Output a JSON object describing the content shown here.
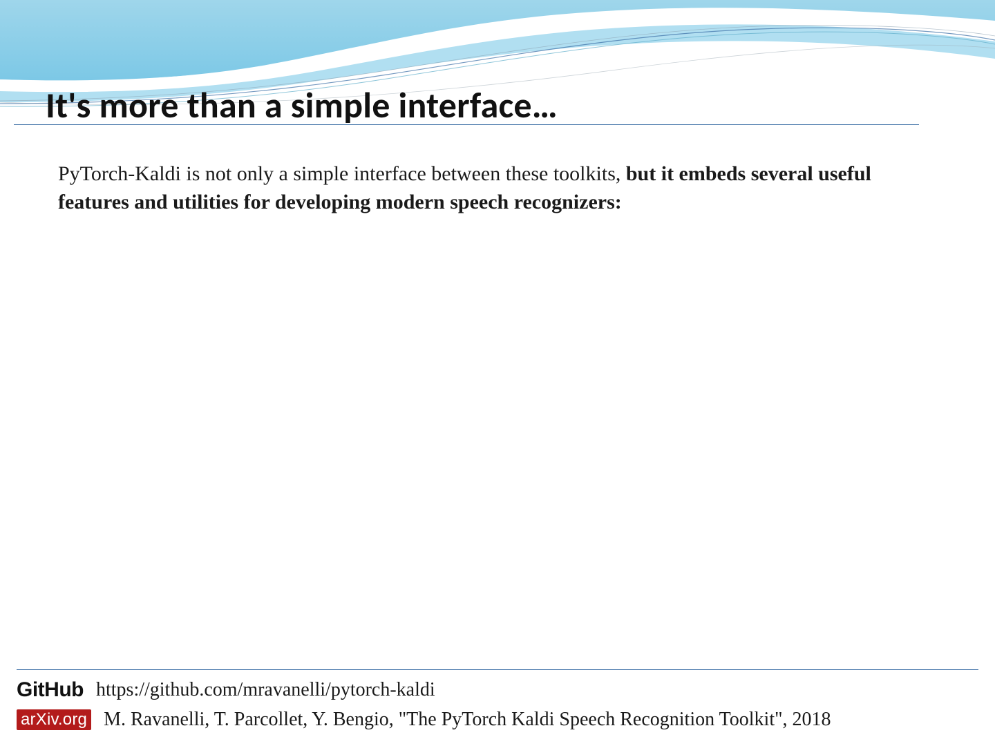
{
  "title": "It's more than a simple interface…",
  "body": {
    "normal": "PyTorch-Kaldi is not only a simple interface between these toolkits, ",
    "bold": "but it embeds several useful features and utilities for developing modern speech recognizers:"
  },
  "footer": {
    "github_label": "GitHub",
    "github_url": "https://github.com/mravanelli/pytorch-kaldi",
    "arxiv_badge": "arXiv.org",
    "citation": "M. Ravanelli, T. Parcollet, Y. Bengio, \"The PyTorch Kaldi Speech Recognition Toolkit\", 2018"
  }
}
